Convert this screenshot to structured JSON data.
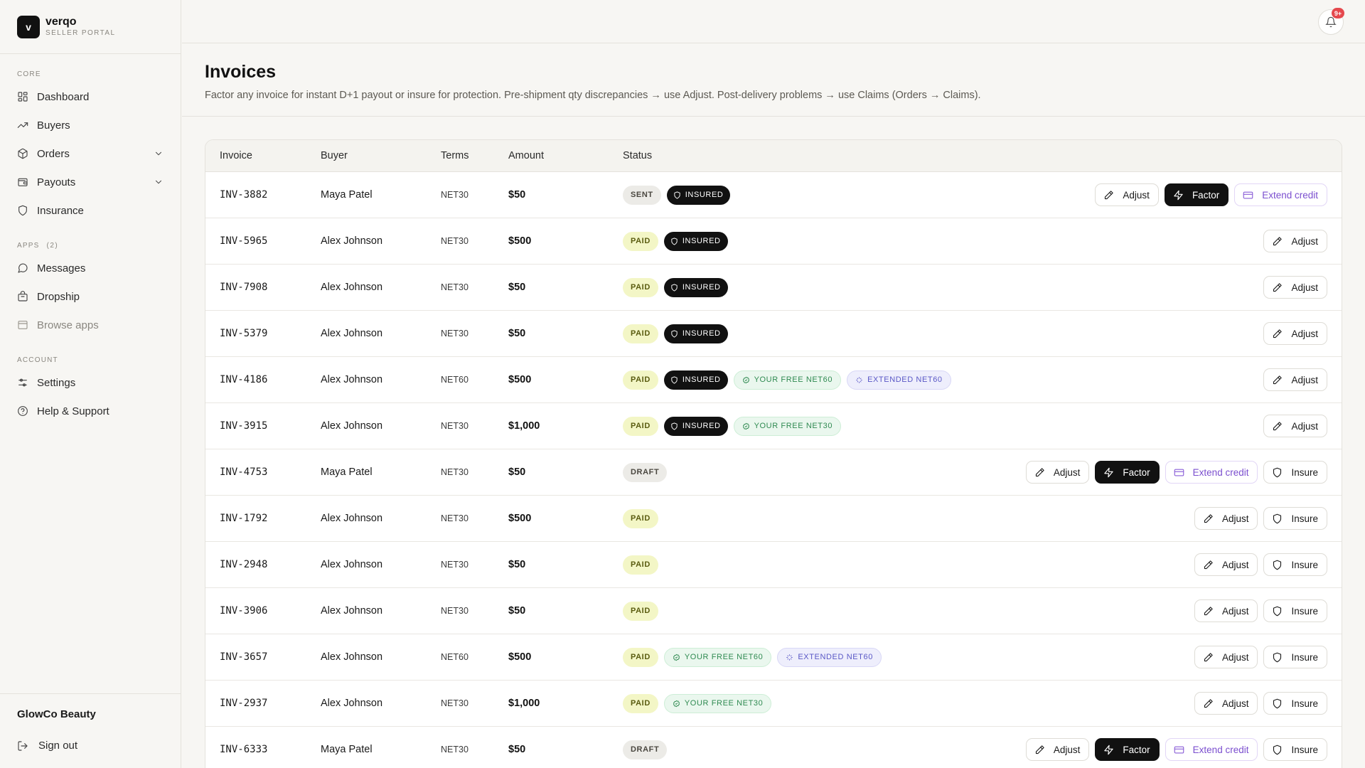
{
  "brand": {
    "logo_letter": "v",
    "name": "verqo",
    "subtitle": "SELLER PORTAL"
  },
  "sidebar": {
    "core_label": "CORE",
    "core_items": [
      {
        "label": "Dashboard",
        "icon": "grid-icon"
      },
      {
        "label": "Buyers",
        "icon": "trending-up-icon"
      },
      {
        "label": "Orders",
        "icon": "box-icon",
        "expandable": true
      },
      {
        "label": "Payouts",
        "icon": "wallet-icon",
        "expandable": true
      },
      {
        "label": "Insurance",
        "icon": "shield-icon"
      }
    ],
    "apps_label": "APPS",
    "apps_count": "(2)",
    "apps_items": [
      {
        "label": "Messages",
        "icon": "message-icon"
      },
      {
        "label": "Dropship",
        "icon": "package-icon"
      },
      {
        "label": "Browse apps",
        "icon": "browser-icon"
      }
    ],
    "account_label": "ACCOUNT",
    "account_items": [
      {
        "label": "Settings",
        "icon": "sliders-icon"
      },
      {
        "label": "Help & Support",
        "icon": "help-icon"
      }
    ],
    "org_name": "GlowCo Beauty",
    "signout_label": "Sign out"
  },
  "topbar": {
    "notification_count": "9+"
  },
  "page": {
    "title": "Invoices",
    "subtitle": "Factor any invoice for instant D+1 payout or insure for protection. Pre-shipment qty discrepancies → use Adjust. Post-delivery problems → use Claims (Orders → Claims)."
  },
  "table": {
    "columns": [
      "Invoice",
      "Buyer",
      "Terms",
      "Amount",
      "Status"
    ],
    "rows": [
      {
        "invoice": "INV-3882",
        "buyer": "Maya Patel",
        "terms": "NET30",
        "amount": "$50",
        "status": "SENT",
        "insured": "INSURED",
        "extras": [],
        "actions": [
          "Adjust",
          "Factor",
          "Extend credit"
        ]
      },
      {
        "invoice": "INV-5965",
        "buyer": "Alex Johnson",
        "terms": "NET30",
        "amount": "$500",
        "status": "PAID",
        "insured": "INSURED",
        "extras": [],
        "actions": [
          "Adjust"
        ]
      },
      {
        "invoice": "INV-7908",
        "buyer": "Alex Johnson",
        "terms": "NET30",
        "amount": "$50",
        "status": "PAID",
        "insured": "INSURED",
        "extras": [],
        "actions": [
          "Adjust"
        ]
      },
      {
        "invoice": "INV-5379",
        "buyer": "Alex Johnson",
        "terms": "NET30",
        "amount": "$50",
        "status": "PAID",
        "insured": "INSURED",
        "extras": [],
        "actions": [
          "Adjust"
        ]
      },
      {
        "invoice": "INV-4186",
        "buyer": "Alex Johnson",
        "terms": "NET60",
        "amount": "$500",
        "status": "PAID",
        "insured": "INSURED",
        "extras": [
          {
            "type": "free",
            "label": "YOUR FREE NET60"
          },
          {
            "type": "ext",
            "label": "EXTENDED NET60"
          }
        ],
        "actions": [
          "Adjust"
        ]
      },
      {
        "invoice": "INV-3915",
        "buyer": "Alex Johnson",
        "terms": "NET30",
        "amount": "$1,000",
        "status": "PAID",
        "insured": "INSURED",
        "extras": [
          {
            "type": "free",
            "label": "YOUR FREE NET30"
          }
        ],
        "actions": [
          "Adjust"
        ]
      },
      {
        "invoice": "INV-4753",
        "buyer": "Maya Patel",
        "terms": "NET30",
        "amount": "$50",
        "status": "DRAFT",
        "insured": "",
        "extras": [],
        "actions": [
          "Adjust",
          "Factor",
          "Extend credit",
          "Insure"
        ]
      },
      {
        "invoice": "INV-1792",
        "buyer": "Alex Johnson",
        "terms": "NET30",
        "amount": "$500",
        "status": "PAID",
        "insured": "",
        "extras": [],
        "actions": [
          "Adjust",
          "Insure"
        ]
      },
      {
        "invoice": "INV-2948",
        "buyer": "Alex Johnson",
        "terms": "NET30",
        "amount": "$50",
        "status": "PAID",
        "insured": "",
        "extras": [],
        "actions": [
          "Adjust",
          "Insure"
        ]
      },
      {
        "invoice": "INV-3906",
        "buyer": "Alex Johnson",
        "terms": "NET30",
        "amount": "$50",
        "status": "PAID",
        "insured": "",
        "extras": [],
        "actions": [
          "Adjust",
          "Insure"
        ]
      },
      {
        "invoice": "INV-3657",
        "buyer": "Alex Johnson",
        "terms": "NET60",
        "amount": "$500",
        "status": "PAID",
        "insured": "",
        "extras": [
          {
            "type": "free",
            "label": "YOUR FREE NET60"
          },
          {
            "type": "ext",
            "label": "EXTENDED NET60"
          }
        ],
        "actions": [
          "Adjust",
          "Insure"
        ]
      },
      {
        "invoice": "INV-2937",
        "buyer": "Alex Johnson",
        "terms": "NET30",
        "amount": "$1,000",
        "status": "PAID",
        "insured": "",
        "extras": [
          {
            "type": "free",
            "label": "YOUR FREE NET30"
          }
        ],
        "actions": [
          "Adjust",
          "Insure"
        ]
      },
      {
        "invoice": "INV-6333",
        "buyer": "Maya Patel",
        "terms": "NET30",
        "amount": "$50",
        "status": "DRAFT",
        "insured": "",
        "extras": [],
        "actions": [
          "Adjust",
          "Factor",
          "Extend credit",
          "Insure"
        ]
      }
    ]
  },
  "colors": {
    "accent": "#111111",
    "paid_bg": "#f3f6c6",
    "free_green": "#2f8a51",
    "extended_purple": "#5a58c6",
    "extend_credit": "#7b4fcf",
    "badge_red": "#e5484d"
  }
}
